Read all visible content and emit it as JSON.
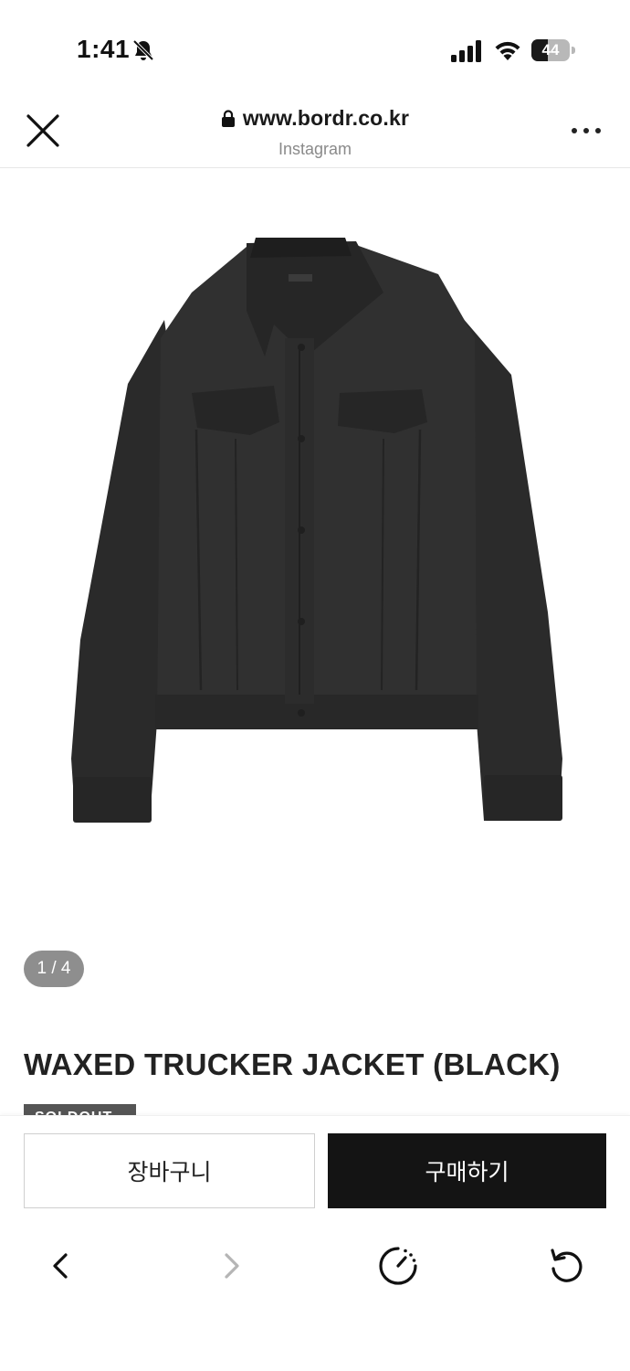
{
  "status_bar": {
    "time": "1:41",
    "battery_level": "44",
    "battery_fraction": 0.44
  },
  "browser": {
    "url": "www.bordr.co.kr",
    "source": "Instagram"
  },
  "product": {
    "image_name": "jacket-image",
    "page_indicator": "1 / 4",
    "title": "WAXED TRUCKER JACKET (BLACK)",
    "badge": "SOLDOUT"
  },
  "actions": {
    "cart_label": "장바구니",
    "buy_label": "구매하기"
  },
  "nav": {
    "icons": [
      "back-icon",
      "forward-icon",
      "speed-icon",
      "reload-icon"
    ]
  },
  "colors": {
    "buy_button": "#141414",
    "badge": "#555555",
    "indicator": "#8e8e8e"
  }
}
